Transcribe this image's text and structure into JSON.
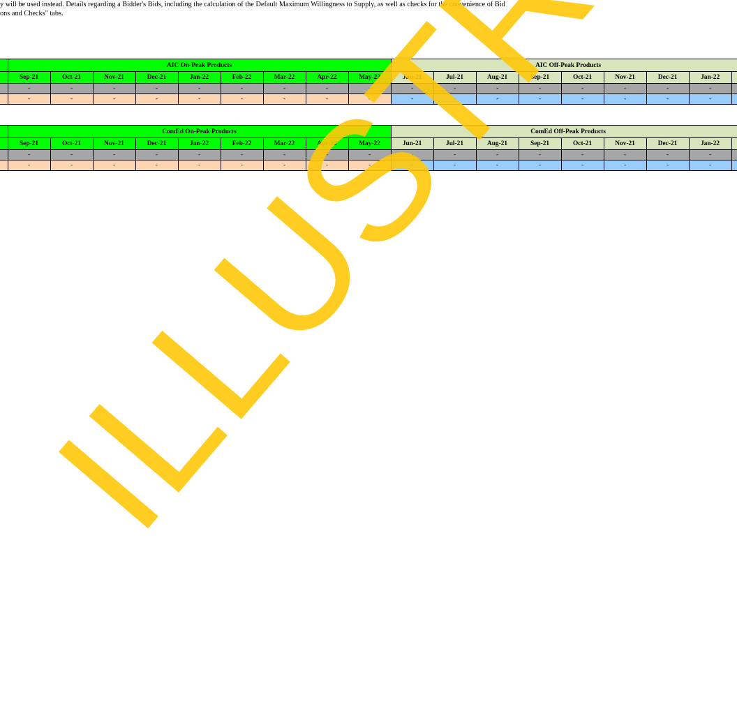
{
  "note": {
    "line1": "y will be used instead. Details regarding a Bidder's Bids, including the calculation of the Default Maximum Willingness to Supply, as well as checks for the convenience of Bid",
    "line2": "ons and Checks\" tabs."
  },
  "watermark": "ILLUSTRATIVE",
  "tables": [
    {
      "on_peak_title": "AIC On-Peak Products",
      "off_peak_title": "AIC Off-Peak Products",
      "on_months": [
        "Sep-21",
        "Oct-21",
        "Nov-21",
        "Dec-21",
        "Jan-22",
        "Feb-22",
        "Mar-22",
        "Apr-22",
        "May-22"
      ],
      "off_months": [
        "Jun-21",
        "Jul-21",
        "Aug-21",
        "Sep-21",
        "Oct-21",
        "Nov-21",
        "Dec-21",
        "Jan-22"
      ],
      "cell_value": "-"
    },
    {
      "on_peak_title": "ComEd On-Peak Products",
      "off_peak_title": "ComEd Off-Peak Products",
      "on_months": [
        "Sep-21",
        "Oct-21",
        "Nov-21",
        "Dec-21",
        "Jan-22",
        "Feb-22",
        "Mar-22",
        "Apr-22",
        "May-22"
      ],
      "off_months": [
        "Jun-21",
        "Jul-21",
        "Aug-21",
        "Sep-21",
        "Oct-21",
        "Nov-21",
        "Dec-21",
        "Jan-22"
      ],
      "cell_value": "-"
    }
  ],
  "colors": {
    "on_peak_header": "#00ff00",
    "off_peak_header": "#d8e4bc",
    "row1_fill": "#a6a6a6",
    "row2_on_fill": "#fcd5b4",
    "row2_off_fill": "#99ccff",
    "watermark": "#ffc80a"
  }
}
